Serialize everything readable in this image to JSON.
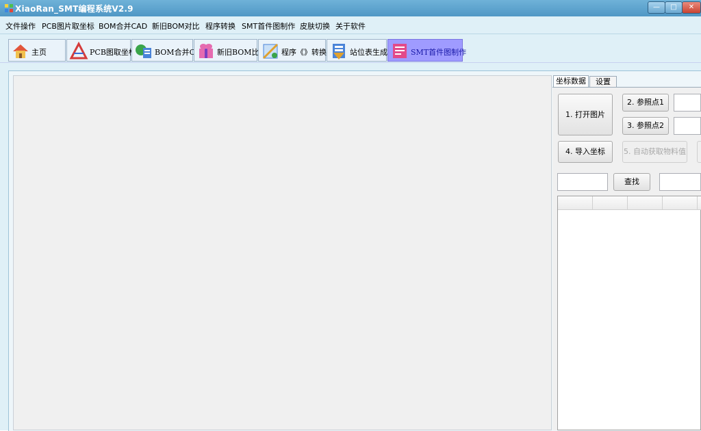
{
  "window": {
    "title": "XiaoRan_SMT编程系统V2.9",
    "controls": {
      "minimize": "—",
      "maximize": "□",
      "close": "✕"
    }
  },
  "menu": [
    "文件操作",
    "PCB图片取坐标",
    "BOM合并CAD",
    "新旧BOM对比",
    "程序转换",
    "SMT首件图制作",
    "皮肤切换",
    "关于软件"
  ],
  "tabs": [
    {
      "label": "主页",
      "icon": "home-icon"
    },
    {
      "label": "PCB图取坐标",
      "icon": "pcb-icon"
    },
    {
      "label": "BOM合并CAD",
      "icon": "merge-icon"
    },
    {
      "label": "新旧BOM比较",
      "icon": "compare-icon"
    },
    {
      "label": "程序《》转换",
      "icon": "convert-icon"
    },
    {
      "label": "站位表生成",
      "icon": "station-table-icon"
    },
    {
      "label": "SMT首件图制作",
      "icon": "first-article-icon"
    }
  ],
  "active_tab": "SMT首件图制作",
  "right_panel": {
    "tabs": [
      "坐标数据",
      "设置"
    ],
    "buttons": {
      "open_image": "1. 打开图片",
      "ref_point1": "2. 参照点1",
      "ref_point2": "3. 参照点2",
      "import_coords": "4. 导入坐标",
      "auto_material": "5. 自动获取物料值",
      "search": "查找"
    },
    "inputs": {
      "ref1_value": "",
      "ref2_value": "",
      "search_left": "",
      "search_right": ""
    },
    "grid": {
      "columns": [
        "",
        "",
        "",
        "",
        ""
      ],
      "rows": []
    }
  },
  "colors": {
    "titlebar": "#5fa6d0",
    "chrome": "#dff0f7",
    "active_tab": "#9f9bff"
  }
}
